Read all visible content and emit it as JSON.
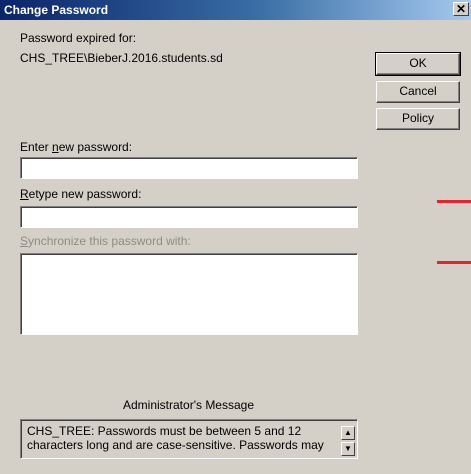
{
  "window": {
    "title": "Change Password",
    "close_glyph": "✕"
  },
  "info": {
    "expired_label": "Password expired for:",
    "account": "CHS_TREE\\BieberJ.2016.students.sd"
  },
  "buttons": {
    "ok": "OK",
    "cancel": "Cancel",
    "policy": "Policy"
  },
  "fields": {
    "new_password_label_pre": "Enter ",
    "new_password_label_accel": "n",
    "new_password_label_post": "ew password:",
    "new_password_value": "",
    "retype_label_accel": "R",
    "retype_label_post": "etype new password:",
    "retype_value": "",
    "sync_label_accel": "S",
    "sync_label_post": "ynchronize this password with:"
  },
  "admin": {
    "heading": "Administrator's Message",
    "message": "CHS_TREE: Passwords must be between 5 and 12 characters long and are case-sensitive. Passwords may"
  },
  "colors": {
    "annotation_red": "#e8212a",
    "titlebar": "#0a246a"
  }
}
